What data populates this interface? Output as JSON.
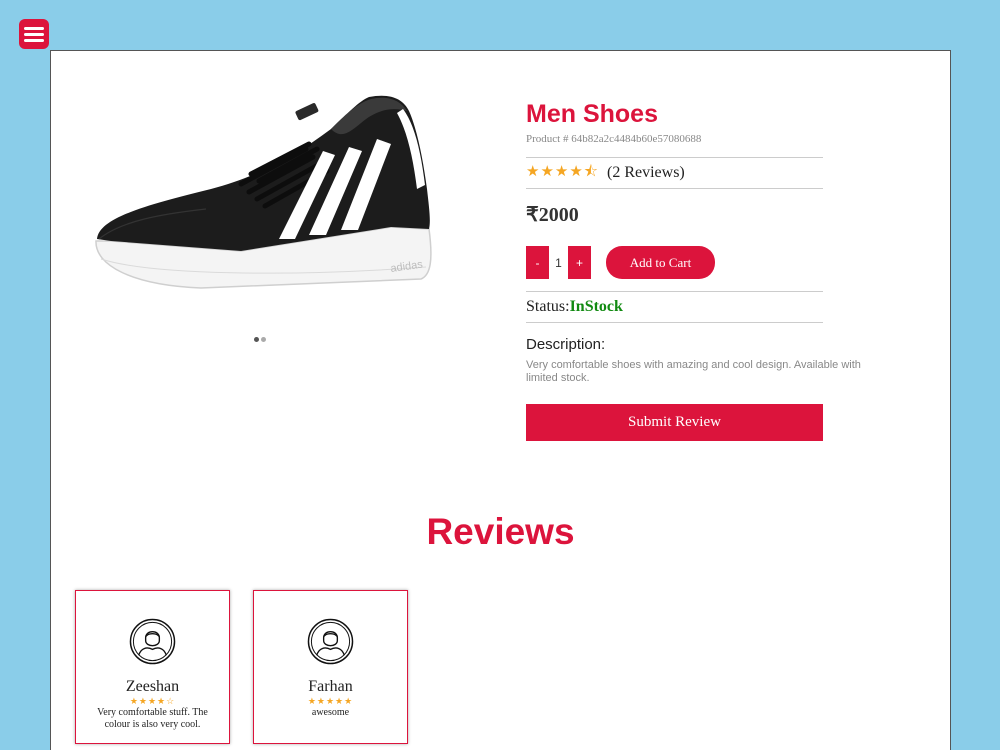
{
  "product": {
    "name": "Men Shoes",
    "id_text": "Product # 64b82a2c4484b60e57080688",
    "stars": "★★★★⯪",
    "reviews_text": "(2 Reviews)",
    "rating": 4.5,
    "price": "₹2000",
    "quantity": "1",
    "minus_label": "-",
    "plus_label": "+",
    "add_to_cart_label": "Add to Cart",
    "status_label": "Status:",
    "status_value": "InStock",
    "description_heading": "Description:",
    "description": "Very comfortable shoes with amazing and cool design. Available with limited stock.",
    "submit_review_label": "Submit Review",
    "shoe_brand_text": "adidas"
  },
  "carousel": {
    "slides": 2,
    "active": 1
  },
  "reviews": {
    "heading": "Reviews",
    "items": [
      {
        "name": "Zeeshan",
        "stars": "★★★★☆",
        "rating": 4,
        "comment": "Very comfortable stuff. The colour is also very cool."
      },
      {
        "name": "Farhan",
        "stars": "★★★★★",
        "rating": 5,
        "comment": "awesome"
      }
    ]
  },
  "colors": {
    "background": "#8acde9",
    "accent": "#dc143c",
    "star": "#f5a623",
    "in_stock": "#118a11"
  }
}
